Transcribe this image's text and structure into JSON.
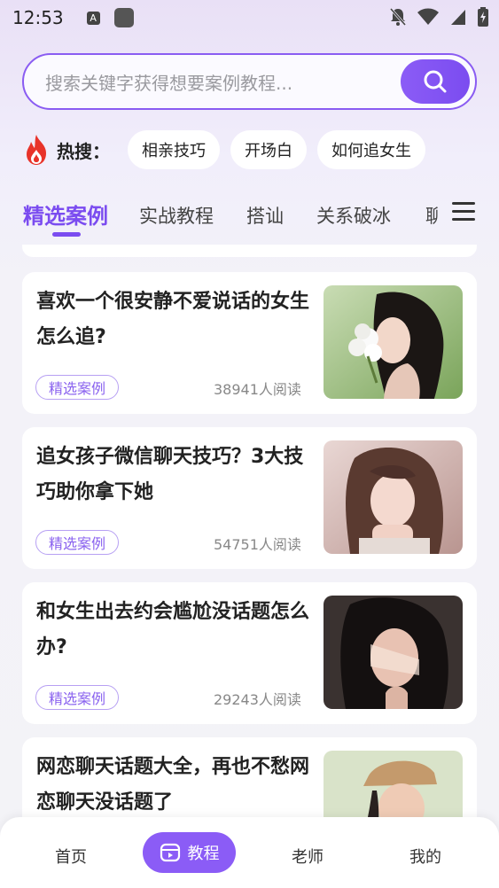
{
  "status": {
    "time": "12:53",
    "a_icon_letter": "A"
  },
  "search": {
    "placeholder": "搜索关键字获得想要案例教程..."
  },
  "hot": {
    "label": "热搜：",
    "chips": [
      "相亲技巧",
      "开场白",
      "如何追女生"
    ]
  },
  "tabs": [
    {
      "label": "精选案例",
      "active": true
    },
    {
      "label": "实战教程"
    },
    {
      "label": "搭讪"
    },
    {
      "label": "关系破冰"
    },
    {
      "label": "聊"
    }
  ],
  "cards": [
    {
      "title": "喜欢一个很安静不爱说话的女生怎么追?",
      "tag": "精选案例",
      "reads": "38941人阅读",
      "image": "girl-with-white-flowers"
    },
    {
      "title": "追女孩子微信聊天技巧？3大技巧助你拿下她",
      "tag": "精选案例",
      "reads": "54751人阅读",
      "image": "girl-chin-on-hands"
    },
    {
      "title": "和女生出去约会尴尬没话题怎么办?",
      "tag": "精选案例",
      "reads": "29243人阅读",
      "image": "girl-in-shadow"
    },
    {
      "title": "网恋聊天话题大全，再也不愁网恋聊天没话题了",
      "image": "girl-with-cap"
    }
  ],
  "nav": {
    "items": [
      "首页",
      "教程",
      "老师",
      "我的"
    ],
    "active": "教程"
  },
  "colors": {
    "accent": "#7b4cf0",
    "hot_fire": "#e8332a"
  }
}
